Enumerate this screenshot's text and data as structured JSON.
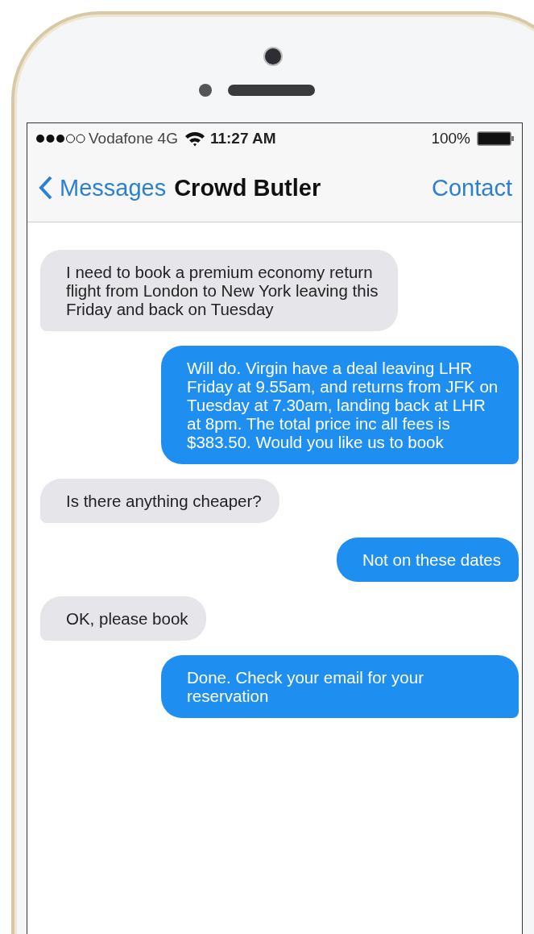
{
  "status_bar": {
    "carrier": "Vodafone 4G",
    "time": "11:27 AM",
    "battery": "100%"
  },
  "nav": {
    "back": "Messages",
    "title": "Crowd Butler",
    "action": "Contact"
  },
  "messages": [
    {
      "kind": "received",
      "text": "I need to book a premium economy return flight from London to New York leaving this Friday and back on Tuesday"
    },
    {
      "kind": "sent",
      "text": "Will do. Virgin have a deal leaving LHR Friday at 9.55am, and returns from JFK on Tuesday at 7.30am, landing back at LHR at 8pm. The total price inc all fees is $383.50. Would you like us to book"
    },
    {
      "kind": "received",
      "text": "Is there anything cheaper?"
    },
    {
      "kind": "sent",
      "text": "Not on these dates"
    },
    {
      "kind": "received",
      "text": "OK, please book"
    },
    {
      "kind": "sent",
      "text": "Done. Check your email for your reservation"
    }
  ]
}
